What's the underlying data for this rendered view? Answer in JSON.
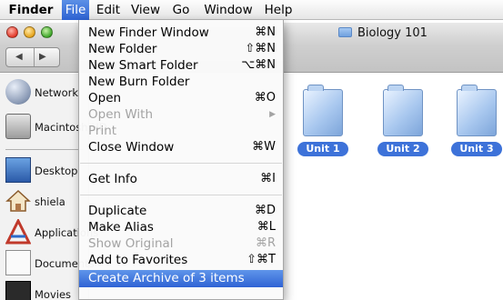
{
  "menubar": {
    "items": [
      {
        "label": "Finder"
      },
      {
        "label": "File"
      },
      {
        "label": "Edit"
      },
      {
        "label": "View"
      },
      {
        "label": "Go"
      },
      {
        "label": "Window"
      },
      {
        "label": "Help"
      }
    ]
  },
  "window": {
    "title": "Biology 101"
  },
  "sidebar": {
    "items": [
      {
        "label": "Network",
        "icon": "network-globe-icon"
      },
      {
        "label": "Macintosh HD",
        "icon": "hard-disk-icon"
      },
      {
        "label": "Desktop",
        "icon": "desktop-icon"
      },
      {
        "label": "shiela",
        "icon": "home-icon"
      },
      {
        "label": "Applications",
        "icon": "applications-icon"
      },
      {
        "label": "Documents",
        "icon": "documents-icon"
      },
      {
        "label": "Movies",
        "icon": "movies-icon"
      }
    ]
  },
  "content": {
    "folders": [
      {
        "label": "Unit 1",
        "icon": "folder-icon"
      },
      {
        "label": "Unit 2",
        "icon": "folder-icon"
      },
      {
        "label": "Unit 3",
        "icon": "folder-icon"
      }
    ]
  },
  "file_menu": {
    "items": [
      {
        "label": "New Finder Window",
        "shortcut": "⌘N",
        "enabled": true
      },
      {
        "label": "New Folder",
        "shortcut": "⇧⌘N",
        "enabled": true
      },
      {
        "label": "New Smart Folder",
        "shortcut": "⌥⌘N",
        "enabled": true
      },
      {
        "label": "New Burn Folder",
        "shortcut": "",
        "enabled": true
      },
      {
        "label": "Open",
        "shortcut": "⌘O",
        "enabled": true
      },
      {
        "label": "Open With",
        "shortcut": "▶",
        "enabled": false
      },
      {
        "label": "Print",
        "shortcut": "",
        "enabled": false
      },
      {
        "label": "Close Window",
        "shortcut": "⌘W",
        "enabled": true
      },
      {
        "label": "Get Info",
        "shortcut": "⌘I",
        "enabled": true
      },
      {
        "label": "Duplicate",
        "shortcut": "⌘D",
        "enabled": true
      },
      {
        "label": "Make Alias",
        "shortcut": "⌘L",
        "enabled": true
      },
      {
        "label": "Show Original",
        "shortcut": "⌘R",
        "enabled": false
      },
      {
        "label": "Add to Favorites",
        "shortcut": "⇧⌘T",
        "enabled": true
      },
      {
        "label": "Create Archive of 3 items",
        "shortcut": "",
        "enabled": true,
        "highlighted": true
      }
    ]
  },
  "colors": {
    "menu_highlight": "#2f63d4",
    "label_badge": "#3d72d9"
  }
}
